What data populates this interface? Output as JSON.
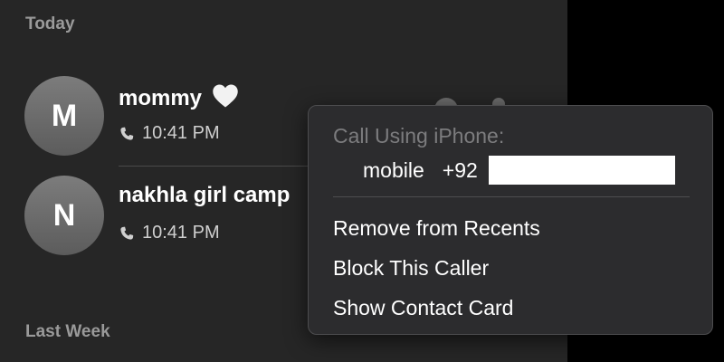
{
  "sections": {
    "today": "Today",
    "last_week": "Last Week"
  },
  "recents": [
    {
      "initial": "M",
      "name": "mommy",
      "emoji_icon": "white-heart-icon",
      "time": "10:41 PM"
    },
    {
      "initial": "N",
      "name": "nakhla girl camp",
      "time": "10:41 PM"
    }
  ],
  "menu": {
    "header": "Call Using iPhone:",
    "number_type": "mobile",
    "number_prefix": "+92",
    "items": [
      "Remove from Recents",
      "Block This Caller",
      "Show Contact Card"
    ]
  },
  "colors": {
    "window_bg": "#262626",
    "menu_bg": "#2c2c2e",
    "secondary_text": "#9a9a9a"
  }
}
